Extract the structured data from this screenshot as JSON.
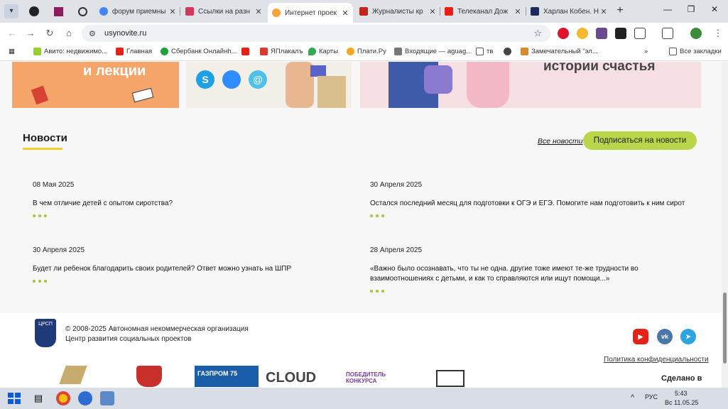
{
  "browser": {
    "tabs": [
      {
        "title": "форум приемны",
        "active": false
      },
      {
        "title": "Ссылки на разн",
        "active": false
      },
      {
        "title": "Интернет проек",
        "active": true
      },
      {
        "title": "Журналисты кр",
        "active": false
      },
      {
        "title": "Телеканал Дож",
        "active": false
      },
      {
        "title": "Харлан Кобен. Н",
        "active": false
      }
    ],
    "url": "usynovite.ru",
    "bookmarks": [
      "Авито: недвижимо...",
      "Главная",
      "Сбербанк Онлайнh...",
      "",
      "ЯПлакалъ",
      "Карты",
      "Плати.Ру",
      "Входящие — aguag...",
      "тв",
      "",
      "Замечательный \"эл...",
      "Все закладки"
    ]
  },
  "cards": {
    "card1_text": "и лекции",
    "card3_text": "истории счастья"
  },
  "news": {
    "title": "Новости",
    "all_news": "Все новости",
    "subscribe": "Подписаться на новости",
    "items": [
      {
        "date": "08 Мая 2025",
        "text": "В чем отличие детей с опытом сиротства?"
      },
      {
        "date": "30 Апреля 2025",
        "text": "Остался последний месяц для подготовки к ОГЭ и ЕГЭ. Помогите нам подготовить к ним сирот"
      },
      {
        "date": "30 Апреля 2025",
        "text": "Будет ли ребенок благодарить своих родителей? Ответ можно узнать на ШПР"
      },
      {
        "date": "28 Апреля 2025",
        "text": "«Важно было осознавать, что ты не одна. другие тоже имеют те-же трудности во взаимоотношениях с детьми, и как то справляются или ищут помощи...»"
      }
    ]
  },
  "footer": {
    "logo_text": "ЦРСП",
    "copyright_line1": "© 2008-2025 Автономная некоммерческая организация",
    "copyright_line2": "Центр развития социальных проектов",
    "privacy": "Политика конфиденциальности",
    "made_in": "Сделано в",
    "partners": [
      "ГАЗПРОМ 75",
      "CLOUD",
      "ПОБЕДИТЕЛЬ КОНКУРСА"
    ]
  },
  "taskbar": {
    "lang": "РУС",
    "time": "5:43",
    "date": "Вс 11.05.25"
  },
  "colors": {
    "accent_green": "#b9d64a",
    "title_underline": "#f4cf2b",
    "youtube": "#e62117",
    "vk": "#4a76a8",
    "telegram": "#2ca5e0"
  }
}
